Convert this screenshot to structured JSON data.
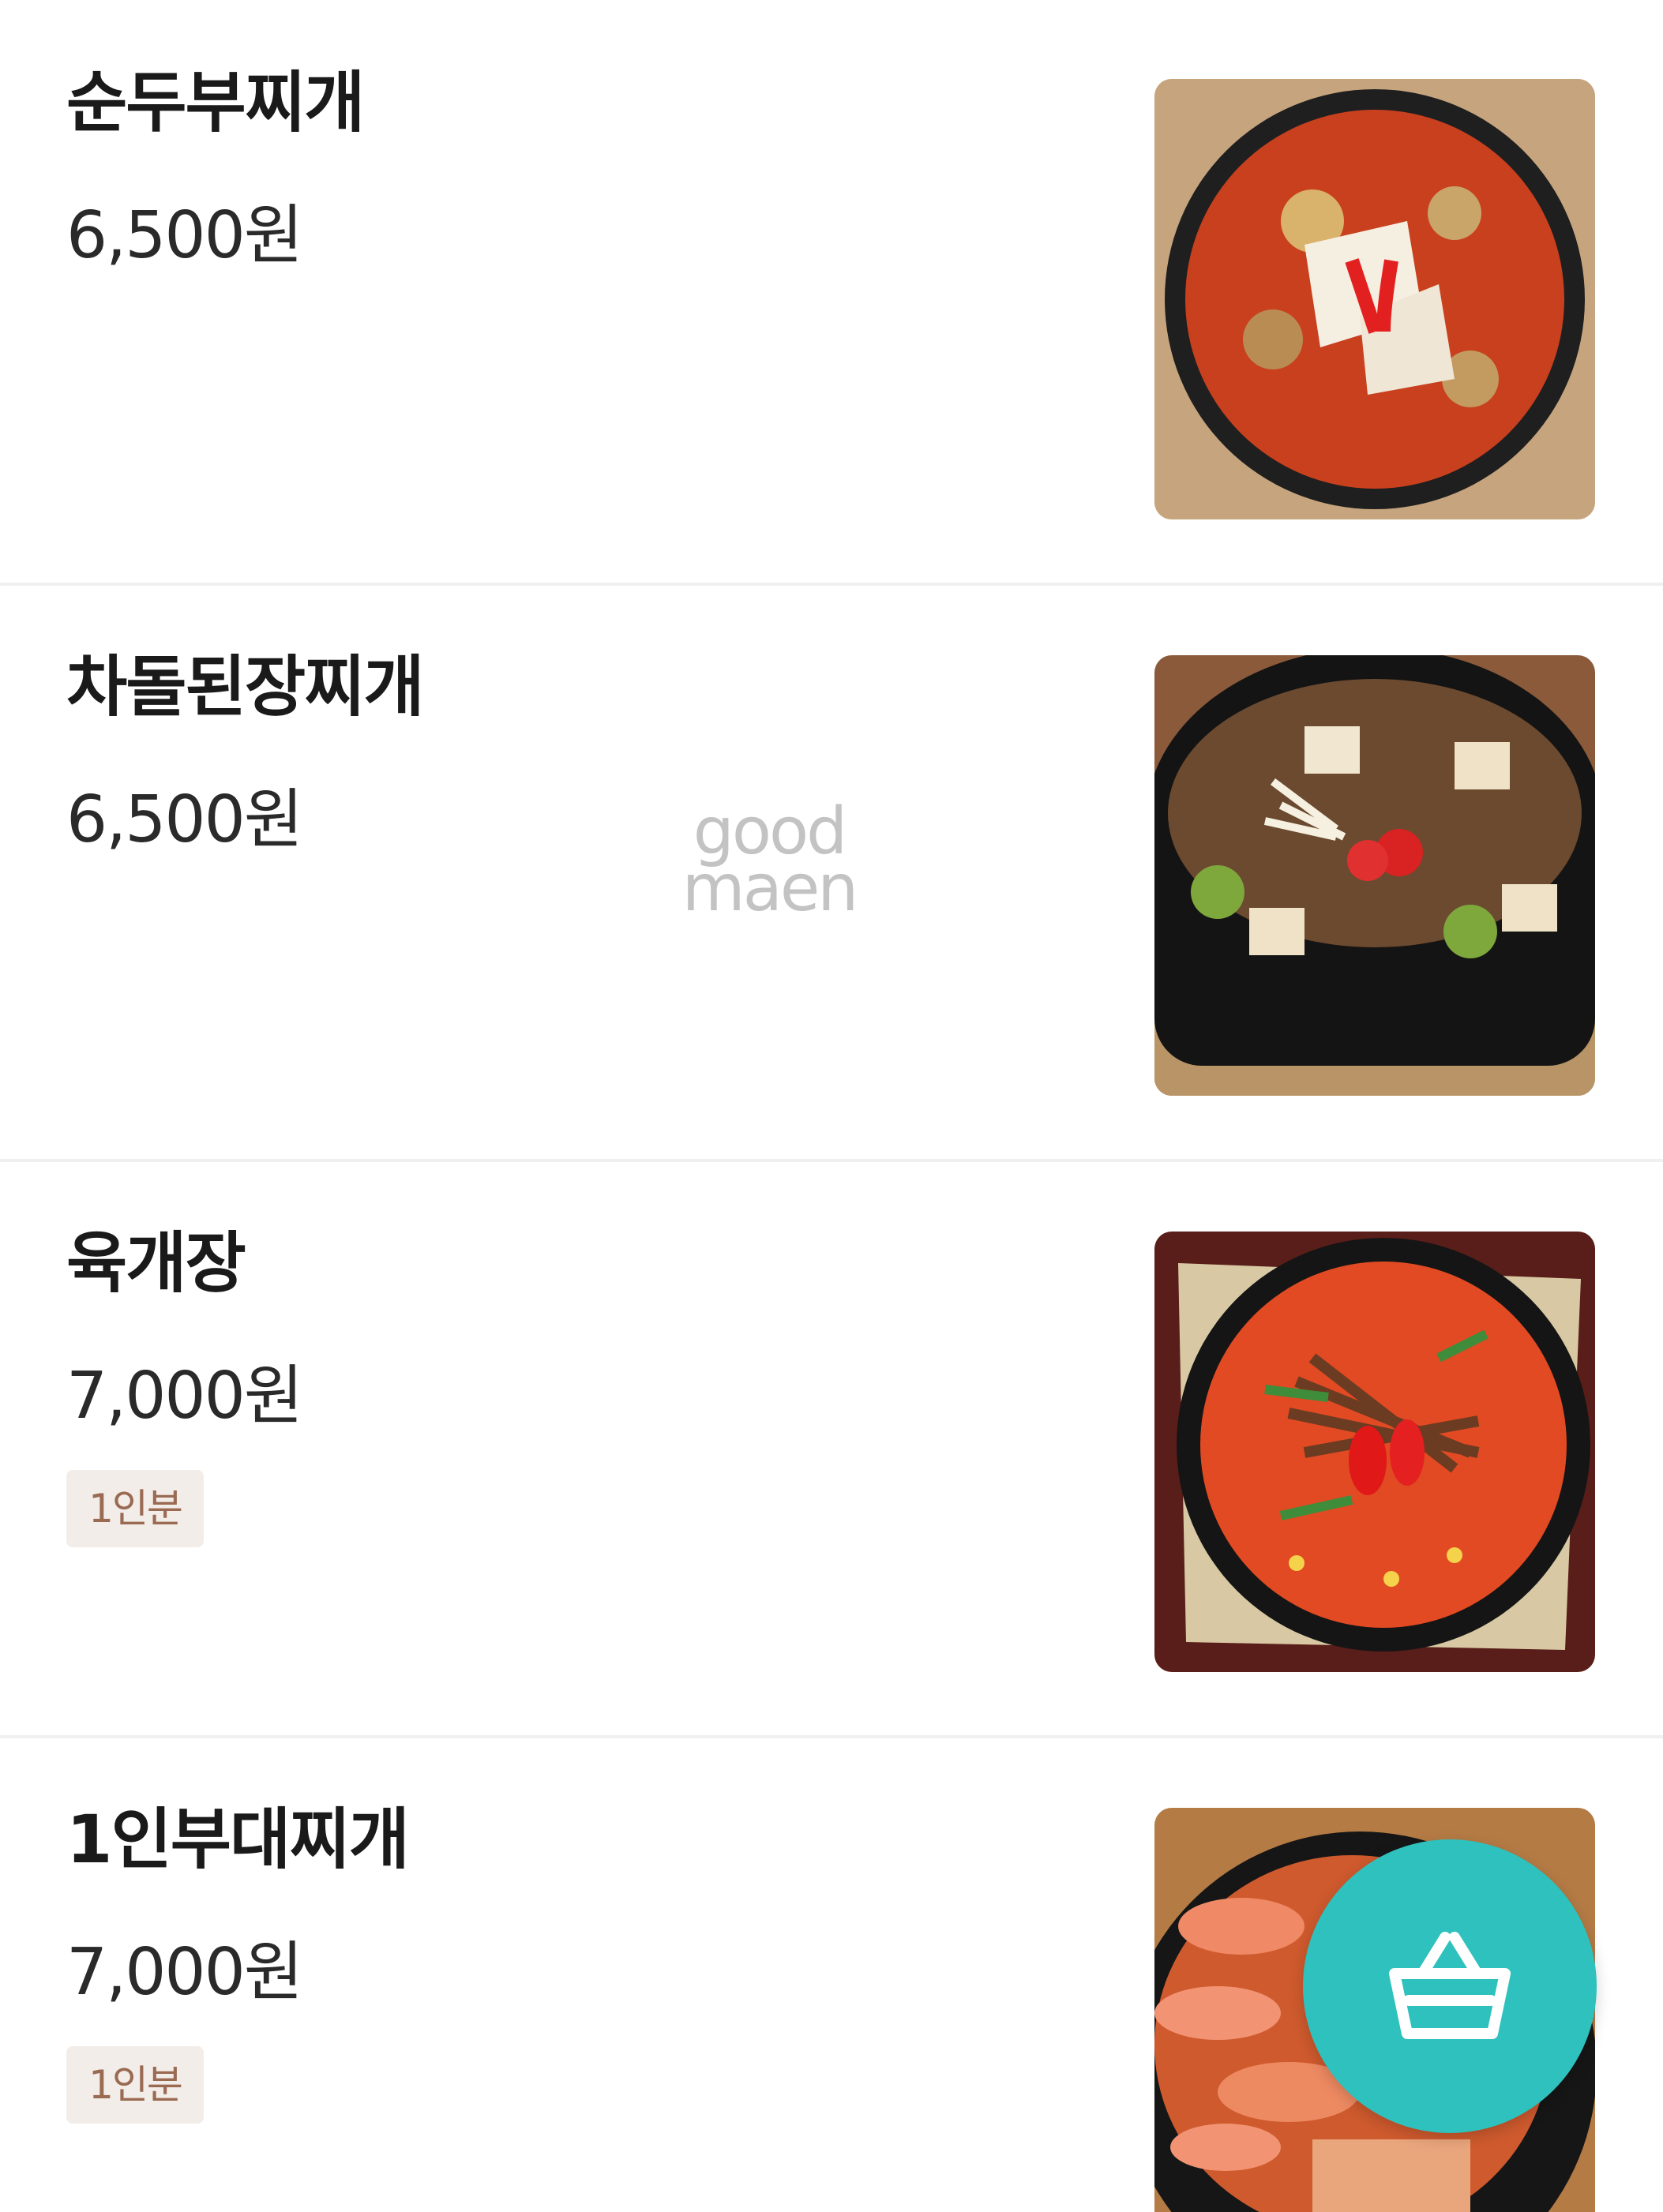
{
  "menu": {
    "items": [
      {
        "name": "순두부찌개",
        "price": "6,500원",
        "tag": "",
        "image": "sundubu-jjigae-photo"
      },
      {
        "name": "차돌된장찌개",
        "price": "6,500원",
        "tag": "",
        "image": "chadol-doenjang-jjigae-photo"
      },
      {
        "name": "육개장",
        "price": "7,000원",
        "tag": "1인분",
        "image": "yukgaejang-photo"
      },
      {
        "name": "1인부대찌개",
        "price": "7,000원",
        "tag": "1인분",
        "image": "budae-jjigae-photo"
      }
    ]
  },
  "watermark": {
    "line1": "good",
    "line2": "maen"
  },
  "cart_button": {
    "icon": "shopping-basket-icon",
    "color": "#2fc1bd"
  },
  "colors": {
    "tag_bg": "#f3ede9",
    "tag_text": "#9a6a52",
    "divider": "#f0f0f0"
  }
}
